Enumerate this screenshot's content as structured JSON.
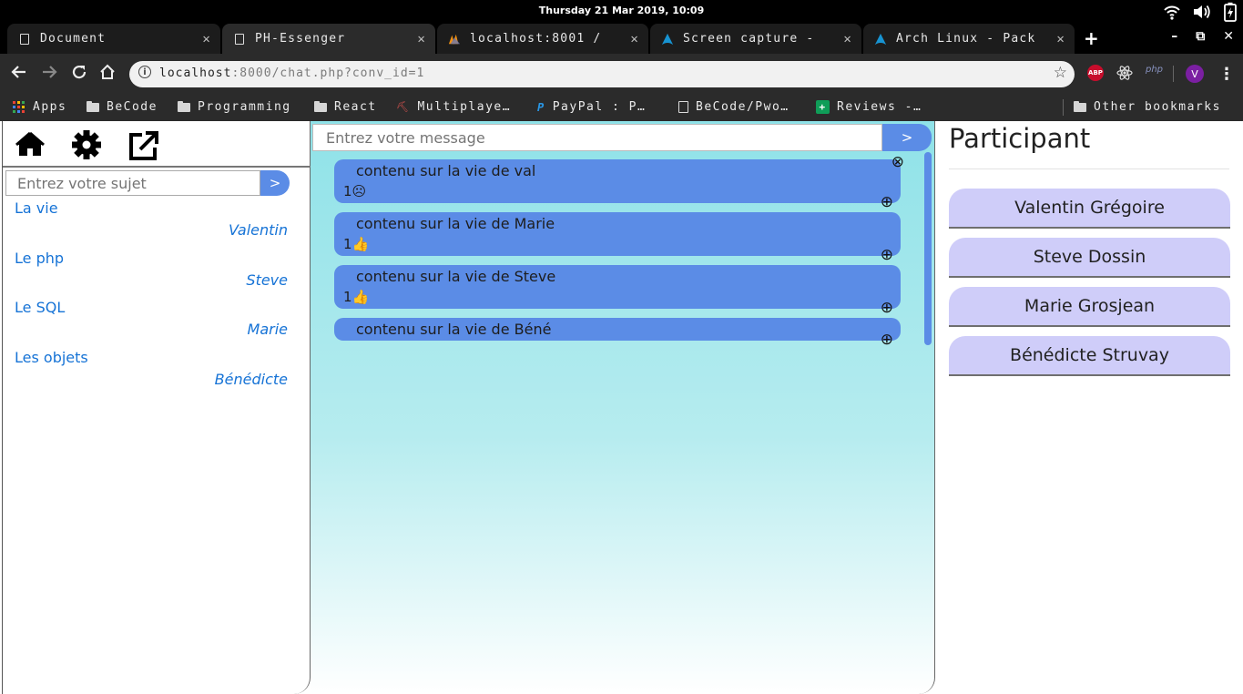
{
  "os": {
    "clock": "Thursday 21 Mar 2019, 10:09",
    "tray_icons": [
      "wifi-icon",
      "volume-icon",
      "battery-icon"
    ]
  },
  "browser": {
    "tabs": [
      {
        "title": "Document",
        "icon": "page-icon",
        "active": false
      },
      {
        "title": "PH-Essenger",
        "icon": "page-icon",
        "active": true
      },
      {
        "title": "localhost:8001 /",
        "icon": "phpmyadmin-icon",
        "active": false
      },
      {
        "title": "Screen capture -",
        "icon": "arch-linux-icon",
        "active": false
      },
      {
        "title": "Arch Linux - Pack",
        "icon": "arch-linux-icon",
        "active": false
      }
    ],
    "tab_close": "✕",
    "new_tab": "+",
    "window_controls": {
      "minimize": "–",
      "restore": "⧉",
      "close": "✕"
    },
    "url_host": "localhost",
    "url_rest": ":8000/chat.php?conv_id=1",
    "extensions": {
      "abp": "ABP",
      "php": "php",
      "avatar_letter": "V"
    },
    "bookmarks": [
      {
        "label": "Apps",
        "icon": "apps-grid-icon"
      },
      {
        "label": "BeCode",
        "icon": "folder-icon"
      },
      {
        "label": "Programming",
        "icon": "folder-icon"
      },
      {
        "label": "React",
        "icon": "folder-icon"
      },
      {
        "label": "Multiplaye…",
        "icon": "multiplayer-icon"
      },
      {
        "label": "PayPal : P…",
        "icon": "paypal-icon"
      },
      {
        "label": "BeCode/Pwo…",
        "icon": "page-icon"
      },
      {
        "label": "Reviews -…",
        "icon": "reviews-icon"
      },
      {
        "label": "Other bookmarks",
        "icon": "folder-icon"
      }
    ]
  },
  "app": {
    "left": {
      "subject_placeholder": "Entrez votre sujet",
      "submit_label": ">",
      "subjects": [
        {
          "title": "La vie",
          "author": "Valentin"
        },
        {
          "title": "Le php",
          "author": "Steve"
        },
        {
          "title": "Le SQL",
          "author": "Marie"
        },
        {
          "title": "Les objets",
          "author": "Bénédicte"
        }
      ]
    },
    "chat": {
      "message_placeholder": "Entrez votre message",
      "send_label": ">",
      "add_symbol": "⊕",
      "delete_symbol": "⊗",
      "messages": [
        {
          "text": "contenu sur la vie de val",
          "reaction": "1☹",
          "deletable": true
        },
        {
          "text": "contenu sur la vie de Marie",
          "reaction": "1👍",
          "deletable": false
        },
        {
          "text": "contenu sur la vie de Steve",
          "reaction": "1👍",
          "deletable": false
        },
        {
          "text": "contenu sur la vie de Béné",
          "reaction": "",
          "deletable": false
        }
      ]
    },
    "participants": {
      "title": "Participant",
      "list": [
        "Valentin Grégoire",
        "Steve Dossin",
        "Marie Grosjean",
        "Bénédicte Struvay"
      ]
    }
  },
  "colors": {
    "accent": "#5b8ce6",
    "link": "#1673d6",
    "participant_bg": "#cfcdf9",
    "chat_bg_top": "#8fe2e8"
  }
}
